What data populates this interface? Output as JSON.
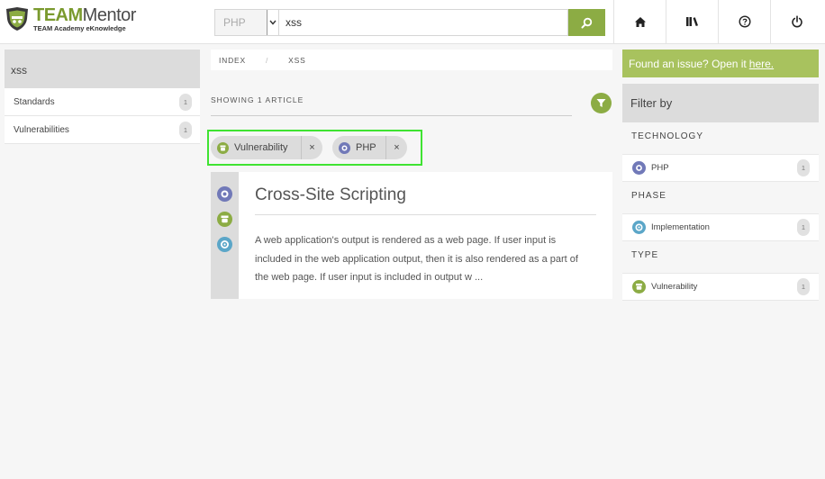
{
  "header": {
    "logo_title_part1": "TEAM",
    "logo_title_part2": "Mentor",
    "logo_subtitle": "TEAM Academy eKnowledge",
    "tech_select_value": "PHP",
    "search_value": "xss",
    "nav_icons": [
      "home-icon",
      "library-icon",
      "help-icon",
      "power-icon"
    ]
  },
  "left_sidebar": {
    "heading": "xss",
    "items": [
      {
        "label": "Standards",
        "count": "1"
      },
      {
        "label": "Vulnerabilities",
        "count": "1"
      }
    ]
  },
  "main": {
    "breadcrumb": [
      "INDEX",
      "XSS"
    ],
    "breadcrumb_sep": "/",
    "showing": "SHOWING 1 ARTICLE",
    "chips": [
      {
        "label": "Vulnerability",
        "remove": "×",
        "icon": "vulnerability-icon"
      },
      {
        "label": "PHP",
        "remove": "×",
        "icon": "php-icon"
      }
    ],
    "article": {
      "title": "Cross-Site Scripting",
      "text": "A web application's output is rendered as a web page. If user input is included in the web application output, then it is also rendered as a part of the web page. If user input is included in output w ...",
      "icons": [
        "php-icon",
        "vulnerability-icon",
        "implementation-icon"
      ]
    }
  },
  "right_sidebar": {
    "issue_text": "Found an issue? Open it",
    "issue_link": "here.",
    "filter_heading": "Filter by",
    "sections": [
      {
        "label": "TECHNOLOGY",
        "item": "PHP",
        "count": "1"
      },
      {
        "label": "PHASE",
        "item": "Implementation",
        "count": "1"
      },
      {
        "label": "TYPE",
        "item": "Vulnerability",
        "count": "1"
      }
    ]
  },
  "colors": {
    "accent_green": "#8cac44",
    "issue_bar": "#a8c25e",
    "highlight_box": "#3fe332",
    "php_purple": "#7179b8",
    "implementation_blue": "#5ba6c8"
  }
}
